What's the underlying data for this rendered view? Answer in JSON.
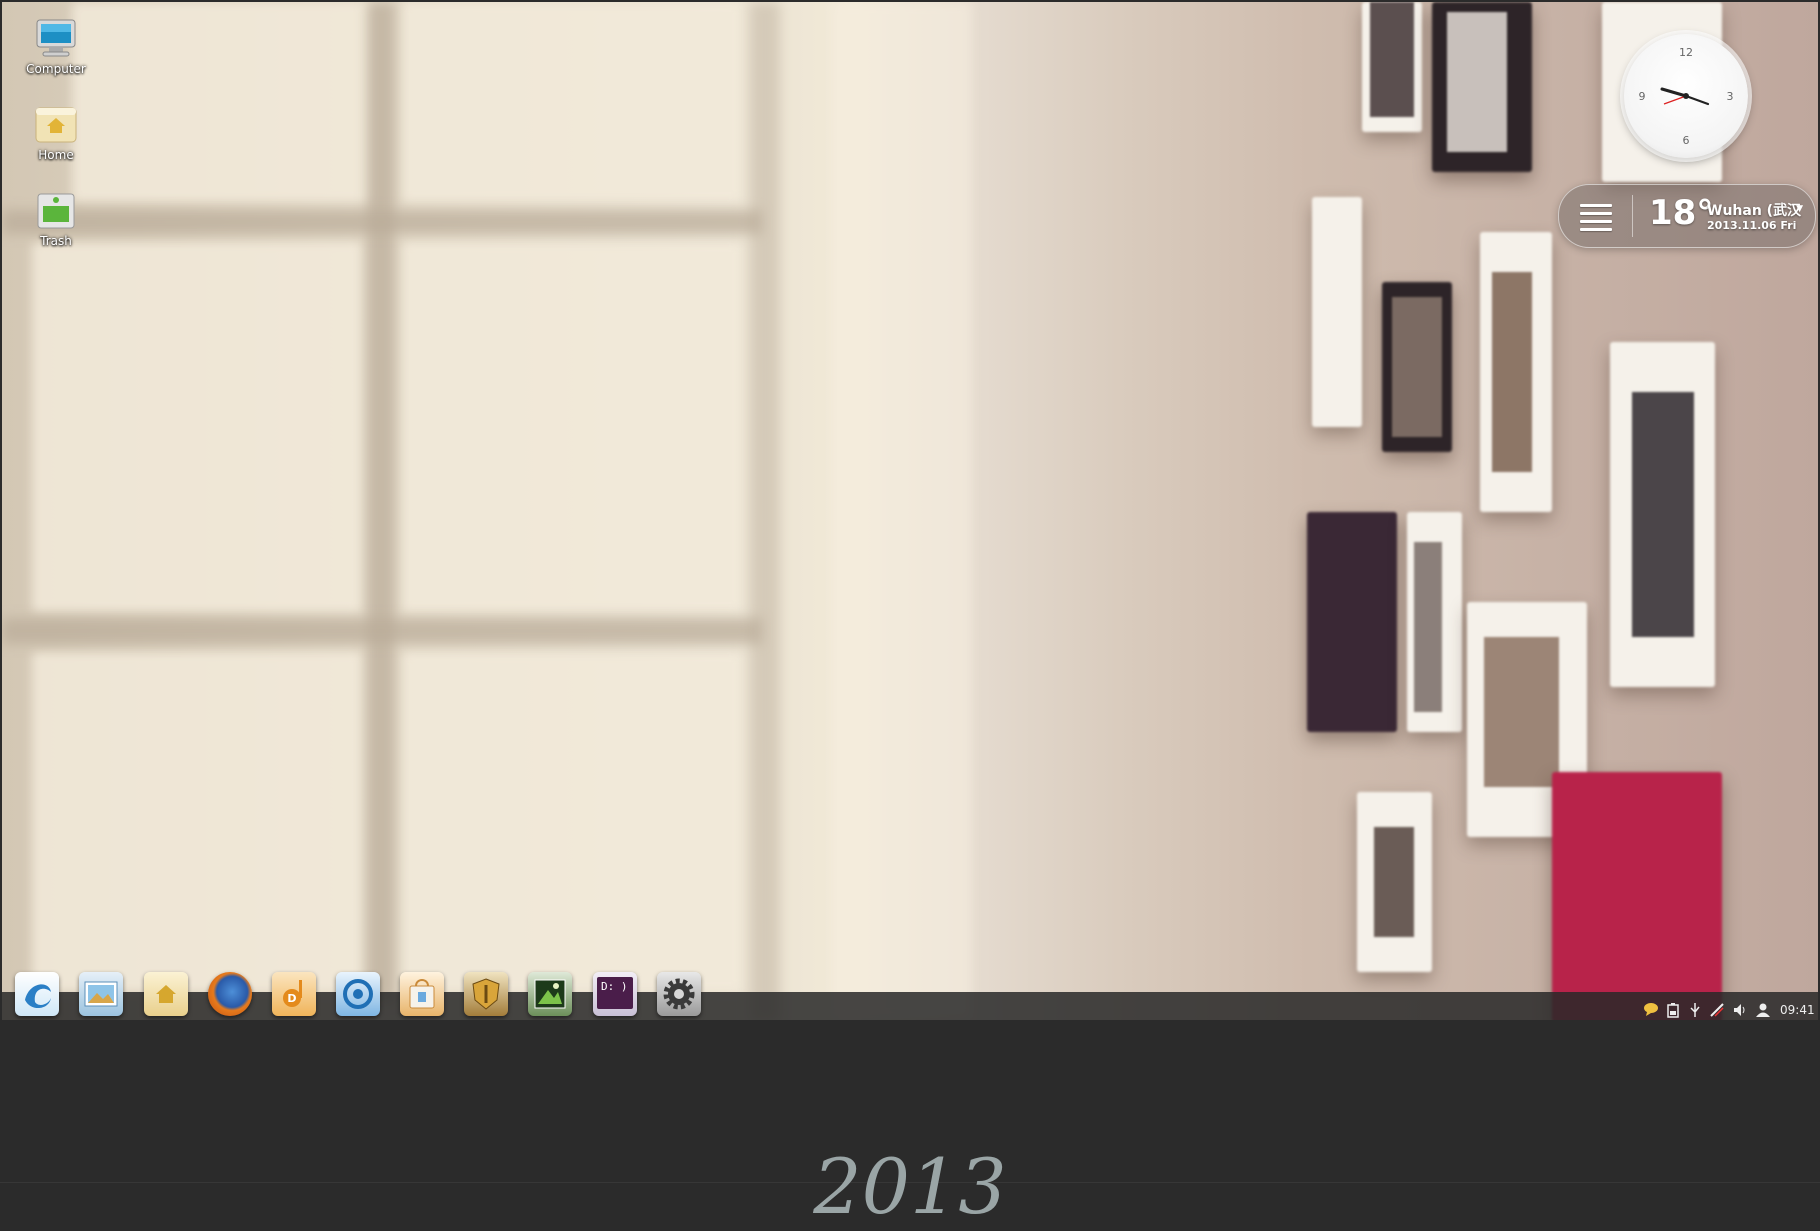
{
  "desktop": {
    "icons": [
      {
        "label": "Computer"
      },
      {
        "label": "Home"
      },
      {
        "label": "Trash"
      }
    ]
  },
  "clock": {
    "numerals": {
      "twelve": "12",
      "three": "3",
      "six": "6",
      "nine": "9"
    }
  },
  "weather": {
    "temperature": "18°",
    "city": "Wuhan (武汉",
    "date": "2013.11.06 Fri"
  },
  "dock": {
    "apps": [
      {
        "icon": "deepin-launcher-icon"
      },
      {
        "icon": "image-viewer-icon"
      },
      {
        "icon": "file-manager-icon"
      },
      {
        "icon": "firefox-icon"
      },
      {
        "icon": "music-player-icon"
      },
      {
        "icon": "media-player-icon"
      },
      {
        "icon": "software-center-icon"
      },
      {
        "icon": "game-center-icon"
      },
      {
        "icon": "screenshot-icon"
      },
      {
        "icon": "terminal-icon",
        "text": "D: )"
      },
      {
        "icon": "system-settings-icon"
      }
    ]
  },
  "tray": {
    "time": "09:41",
    "icons": [
      "chat-icon",
      "battery-icon",
      "usb-icon",
      "network-icon",
      "volume-icon",
      "user-icon"
    ]
  },
  "footer": {
    "year": "2013"
  }
}
